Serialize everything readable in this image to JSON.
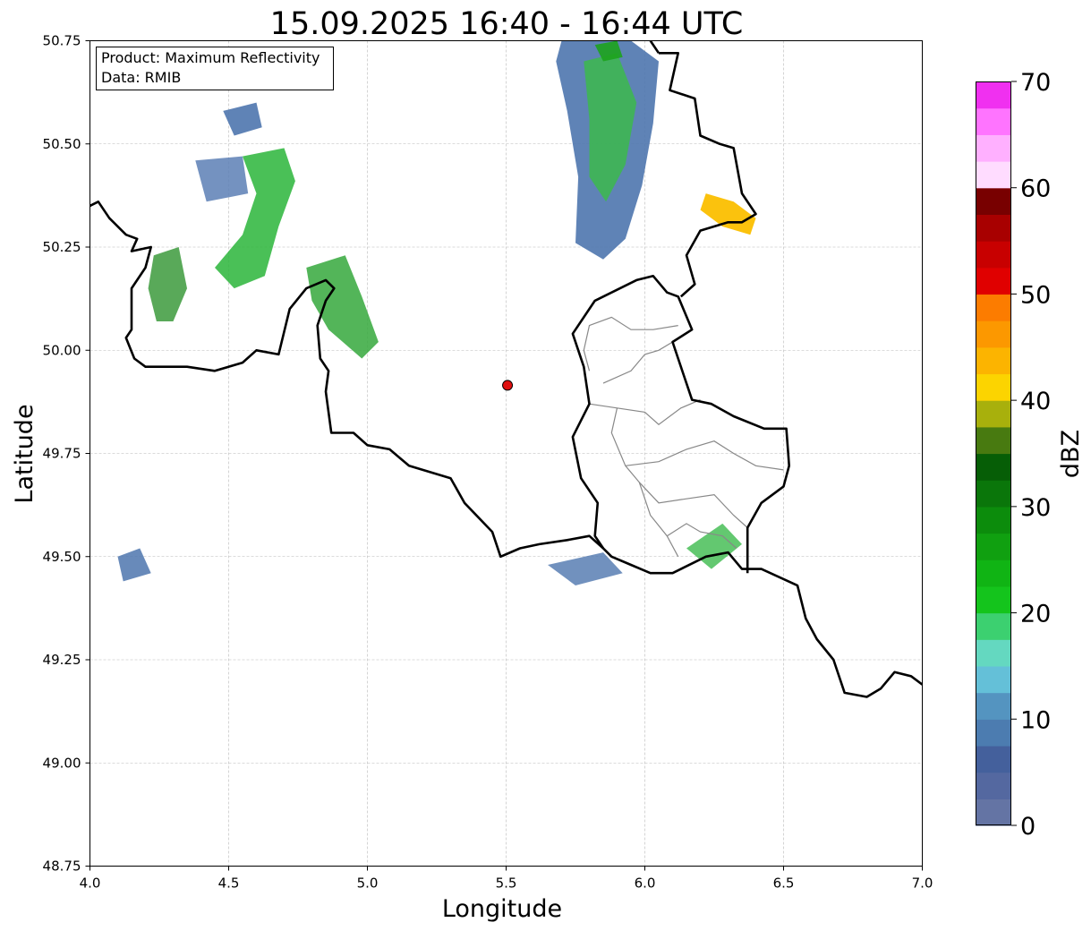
{
  "title": "15.09.2025 16:40 - 16:44 UTC",
  "info_box": {
    "product_line": "Product: Maximum Reflectivity",
    "data_line": "Data: RMIB"
  },
  "x_axis": {
    "label": "Longitude",
    "range": [
      4.0,
      7.0
    ],
    "ticks": [
      "4.0",
      "4.5",
      "5.0",
      "5.5",
      "6.0",
      "6.5",
      "7.0"
    ]
  },
  "y_axis": {
    "label": "Latitude",
    "range": [
      48.75,
      50.75
    ],
    "ticks": [
      "48.75",
      "49.00",
      "49.25",
      "49.50",
      "49.75",
      "50.00",
      "50.25",
      "50.50",
      "50.75"
    ]
  },
  "grid": true,
  "radar_site": {
    "lon": 5.505,
    "lat": 49.915,
    "color": "#e01010"
  },
  "colorbar": {
    "label": "dBZ",
    "range": [
      0,
      70
    ],
    "tick_labels": [
      "0",
      "10",
      "20",
      "30",
      "40",
      "50",
      "60",
      "70"
    ],
    "colors": [
      "#6474a4",
      "#5468a0",
      "#44609c",
      "#4c7cb0",
      "#5494c0",
      "#64c0d8",
      "#64d8c0",
      "#3cd070",
      "#14c41c",
      "#10b414",
      "#10a010",
      "#0c8c0c",
      "#0a760a",
      "#065e06",
      "#487a10",
      "#a8b00c",
      "#fcd400",
      "#fcb400",
      "#fc9800",
      "#fc7c00",
      "#e00000",
      "#c80000",
      "#a80000",
      "#780000",
      "#ffdcff",
      "#ffb0ff",
      "#ff74ff",
      "#f030f0"
    ]
  },
  "reflectivity_areas": [
    {
      "name": "north-central-storm",
      "points": [
        [
          5.7,
          50.75
        ],
        [
          5.95,
          50.75
        ],
        [
          6.05,
          50.7
        ],
        [
          6.03,
          50.55
        ],
        [
          5.99,
          50.4
        ],
        [
          5.93,
          50.27
        ],
        [
          5.85,
          50.22
        ],
        [
          5.75,
          50.26
        ],
        [
          5.76,
          50.42
        ],
        [
          5.72,
          50.58
        ],
        [
          5.68,
          50.7
        ]
      ]
    },
    {
      "name": "north-central-storm-core",
      "points": [
        [
          5.78,
          50.7
        ],
        [
          5.9,
          50.72
        ],
        [
          5.97,
          50.6
        ],
        [
          5.93,
          50.45
        ],
        [
          5.86,
          50.36
        ],
        [
          5.8,
          50.42
        ],
        [
          5.8,
          50.56
        ]
      ]
    },
    {
      "name": "north-central-storm-peak",
      "points": [
        [
          5.82,
          50.74
        ],
        [
          5.9,
          50.75
        ],
        [
          5.92,
          50.71
        ],
        [
          5.85,
          50.7
        ]
      ]
    },
    {
      "name": "east-border-cells",
      "points": [
        [
          6.22,
          50.38
        ],
        [
          6.32,
          50.36
        ],
        [
          6.4,
          50.32
        ],
        [
          6.38,
          50.28
        ],
        [
          6.28,
          50.3
        ],
        [
          6.2,
          50.34
        ]
      ]
    },
    {
      "name": "west-cluster-a",
      "points": [
        [
          4.48,
          50.58
        ],
        [
          4.6,
          50.6
        ],
        [
          4.62,
          50.54
        ],
        [
          4.52,
          50.52
        ]
      ]
    },
    {
      "name": "west-cluster-b",
      "points": [
        [
          4.38,
          50.46
        ],
        [
          4.55,
          50.47
        ],
        [
          4.57,
          50.38
        ],
        [
          4.42,
          50.36
        ]
      ]
    },
    {
      "name": "west-cluster-c",
      "points": [
        [
          4.55,
          50.47
        ],
        [
          4.7,
          50.49
        ],
        [
          4.74,
          50.41
        ],
        [
          4.68,
          50.3
        ],
        [
          4.63,
          50.18
        ],
        [
          4.52,
          50.15
        ],
        [
          4.45,
          50.2
        ],
        [
          4.55,
          50.28
        ],
        [
          4.6,
          50.38
        ]
      ]
    },
    {
      "name": "west-cluster-d",
      "points": [
        [
          4.23,
          50.23
        ],
        [
          4.32,
          50.25
        ],
        [
          4.35,
          50.15
        ],
        [
          4.3,
          50.07
        ],
        [
          4.24,
          50.07
        ],
        [
          4.21,
          50.15
        ]
      ]
    },
    {
      "name": "west-cluster-e",
      "points": [
        [
          4.78,
          50.2
        ],
        [
          4.92,
          50.23
        ],
        [
          4.98,
          50.13
        ],
        [
          5.04,
          50.02
        ],
        [
          4.98,
          49.98
        ],
        [
          4.86,
          50.05
        ],
        [
          4.8,
          50.12
        ]
      ]
    },
    {
      "name": "southwest-cells",
      "points": [
        [
          4.1,
          49.5
        ],
        [
          4.18,
          49.52
        ],
        [
          4.22,
          49.46
        ],
        [
          4.12,
          49.44
        ]
      ]
    },
    {
      "name": "south-east-band",
      "points": [
        [
          6.15,
          49.52
        ],
        [
          6.28,
          49.58
        ],
        [
          6.35,
          49.53
        ],
        [
          6.24,
          49.47
        ]
      ]
    },
    {
      "name": "south-border-band",
      "points": [
        [
          5.65,
          49.48
        ],
        [
          5.85,
          49.51
        ],
        [
          5.92,
          49.46
        ],
        [
          5.75,
          49.43
        ]
      ]
    }
  ],
  "border_lines": [
    {
      "name": "belgium-france-west",
      "points": [
        [
          4.0,
          50.35
        ],
        [
          4.03,
          50.36
        ],
        [
          4.07,
          50.32
        ],
        [
          4.13,
          50.28
        ],
        [
          4.17,
          50.27
        ],
        [
          4.15,
          50.24
        ],
        [
          4.22,
          50.25
        ],
        [
          4.2,
          50.2
        ],
        [
          4.15,
          50.15
        ],
        [
          4.15,
          50.05
        ],
        [
          4.13,
          50.03
        ],
        [
          4.16,
          49.98
        ],
        [
          4.2,
          49.96
        ],
        [
          4.35,
          49.96
        ],
        [
          4.45,
          49.95
        ],
        [
          4.55,
          49.97
        ],
        [
          4.6,
          50.0
        ],
        [
          4.68,
          49.99
        ],
        [
          4.72,
          50.1
        ],
        [
          4.78,
          50.15
        ],
        [
          4.85,
          50.17
        ],
        [
          4.88,
          50.15
        ],
        [
          4.85,
          50.12
        ],
        [
          4.82,
          50.06
        ],
        [
          4.83,
          49.98
        ],
        [
          4.86,
          49.95
        ],
        [
          4.85,
          49.9
        ],
        [
          4.87,
          49.8
        ],
        [
          4.95,
          49.8
        ],
        [
          5.0,
          49.77
        ],
        [
          5.08,
          49.76
        ],
        [
          5.15,
          49.72
        ],
        [
          5.3,
          49.69
        ],
        [
          5.35,
          49.63
        ],
        [
          5.45,
          49.56
        ],
        [
          5.48,
          49.5
        ],
        [
          5.55,
          49.52
        ],
        [
          5.62,
          49.53
        ],
        [
          5.72,
          49.54
        ],
        [
          5.8,
          49.55
        ],
        [
          5.85,
          49.52
        ],
        [
          5.88,
          49.5
        ],
        [
          5.95,
          49.48
        ],
        [
          6.02,
          49.46
        ],
        [
          6.1,
          49.46
        ],
        [
          6.22,
          49.5
        ],
        [
          6.3,
          49.51
        ],
        [
          6.35,
          49.47
        ],
        [
          6.42,
          49.47
        ],
        [
          6.55,
          49.43
        ],
        [
          6.58,
          49.35
        ],
        [
          6.62,
          49.3
        ],
        [
          6.68,
          49.25
        ],
        [
          6.72,
          49.17
        ],
        [
          6.8,
          49.16
        ],
        [
          6.85,
          49.18
        ],
        [
          6.9,
          49.22
        ],
        [
          6.96,
          49.21
        ],
        [
          7.0,
          49.19
        ]
      ]
    },
    {
      "name": "belgium-luxembourg",
      "points": [
        [
          5.85,
          49.52
        ],
        [
          5.82,
          49.55
        ],
        [
          5.83,
          49.63
        ],
        [
          5.77,
          49.69
        ],
        [
          5.74,
          49.79
        ],
        [
          5.8,
          49.87
        ],
        [
          5.78,
          49.96
        ],
        [
          5.74,
          50.04
        ],
        [
          5.82,
          50.12
        ],
        [
          5.97,
          50.17
        ],
        [
          6.03,
          50.18
        ],
        [
          6.08,
          50.14
        ],
        [
          6.12,
          50.13
        ],
        [
          6.17,
          50.05
        ],
        [
          6.1,
          50.02
        ],
        [
          6.12,
          49.98
        ],
        [
          6.17,
          49.88
        ],
        [
          6.24,
          49.87
        ],
        [
          6.32,
          49.84
        ],
        [
          6.43,
          49.81
        ],
        [
          6.51,
          49.81
        ],
        [
          6.52,
          49.72
        ],
        [
          6.5,
          49.67
        ],
        [
          6.42,
          49.63
        ],
        [
          6.37,
          49.57
        ],
        [
          6.37,
          49.46
        ]
      ]
    },
    {
      "name": "belgium-germany-east",
      "points": [
        [
          6.05,
          50.72
        ],
        [
          6.02,
          50.75
        ]
      ]
    },
    {
      "name": "belgium-germany-east-2",
      "points": [
        [
          6.05,
          50.72
        ],
        [
          6.12,
          50.72
        ],
        [
          6.09,
          50.63
        ],
        [
          6.18,
          50.61
        ],
        [
          6.2,
          50.52
        ],
        [
          6.27,
          50.5
        ],
        [
          6.32,
          50.49
        ],
        [
          6.35,
          50.38
        ],
        [
          6.4,
          50.33
        ],
        [
          6.35,
          50.31
        ],
        [
          6.3,
          50.31
        ],
        [
          6.2,
          50.29
        ],
        [
          6.15,
          50.23
        ],
        [
          6.18,
          50.16
        ],
        [
          6.13,
          50.13
        ]
      ]
    }
  ],
  "province_lines": [
    {
      "name": "lux-province-a",
      "points": [
        [
          5.8,
          49.87
        ],
        [
          5.9,
          49.86
        ],
        [
          6.0,
          49.85
        ],
        [
          6.05,
          49.82
        ],
        [
          6.13,
          49.86
        ],
        [
          6.2,
          49.88
        ]
      ]
    },
    {
      "name": "lux-province-b",
      "points": [
        [
          5.9,
          49.86
        ],
        [
          5.88,
          49.8
        ],
        [
          5.93,
          49.72
        ],
        [
          5.98,
          49.68
        ],
        [
          6.02,
          49.6
        ],
        [
          6.08,
          49.55
        ],
        [
          6.12,
          49.5
        ]
      ]
    },
    {
      "name": "lux-province-c",
      "points": [
        [
          5.93,
          49.72
        ],
        [
          6.05,
          49.73
        ],
        [
          6.15,
          49.76
        ],
        [
          6.25,
          49.78
        ],
        [
          6.32,
          49.75
        ],
        [
          6.4,
          49.72
        ],
        [
          6.5,
          49.71
        ]
      ]
    },
    {
      "name": "lux-province-d",
      "points": [
        [
          5.98,
          49.68
        ],
        [
          6.05,
          49.63
        ],
        [
          6.15,
          49.64
        ],
        [
          6.25,
          49.65
        ],
        [
          6.32,
          49.6
        ],
        [
          6.37,
          49.57
        ]
      ]
    },
    {
      "name": "lux-province-e",
      "points": [
        [
          5.85,
          49.92
        ],
        [
          5.95,
          49.95
        ],
        [
          6.0,
          49.99
        ],
        [
          6.05,
          50.0
        ],
        [
          6.1,
          50.02
        ]
      ]
    },
    {
      "name": "lux-province-f",
      "points": [
        [
          5.8,
          49.95
        ],
        [
          5.78,
          50.0
        ],
        [
          5.8,
          50.06
        ],
        [
          5.88,
          50.08
        ],
        [
          5.95,
          50.05
        ],
        [
          6.03,
          50.05
        ],
        [
          6.12,
          50.06
        ]
      ]
    },
    {
      "name": "lux-province-g",
      "points": [
        [
          6.08,
          49.55
        ],
        [
          6.15,
          49.58
        ],
        [
          6.2,
          49.56
        ],
        [
          6.28,
          49.55
        ],
        [
          6.33,
          49.52
        ]
      ]
    }
  ]
}
